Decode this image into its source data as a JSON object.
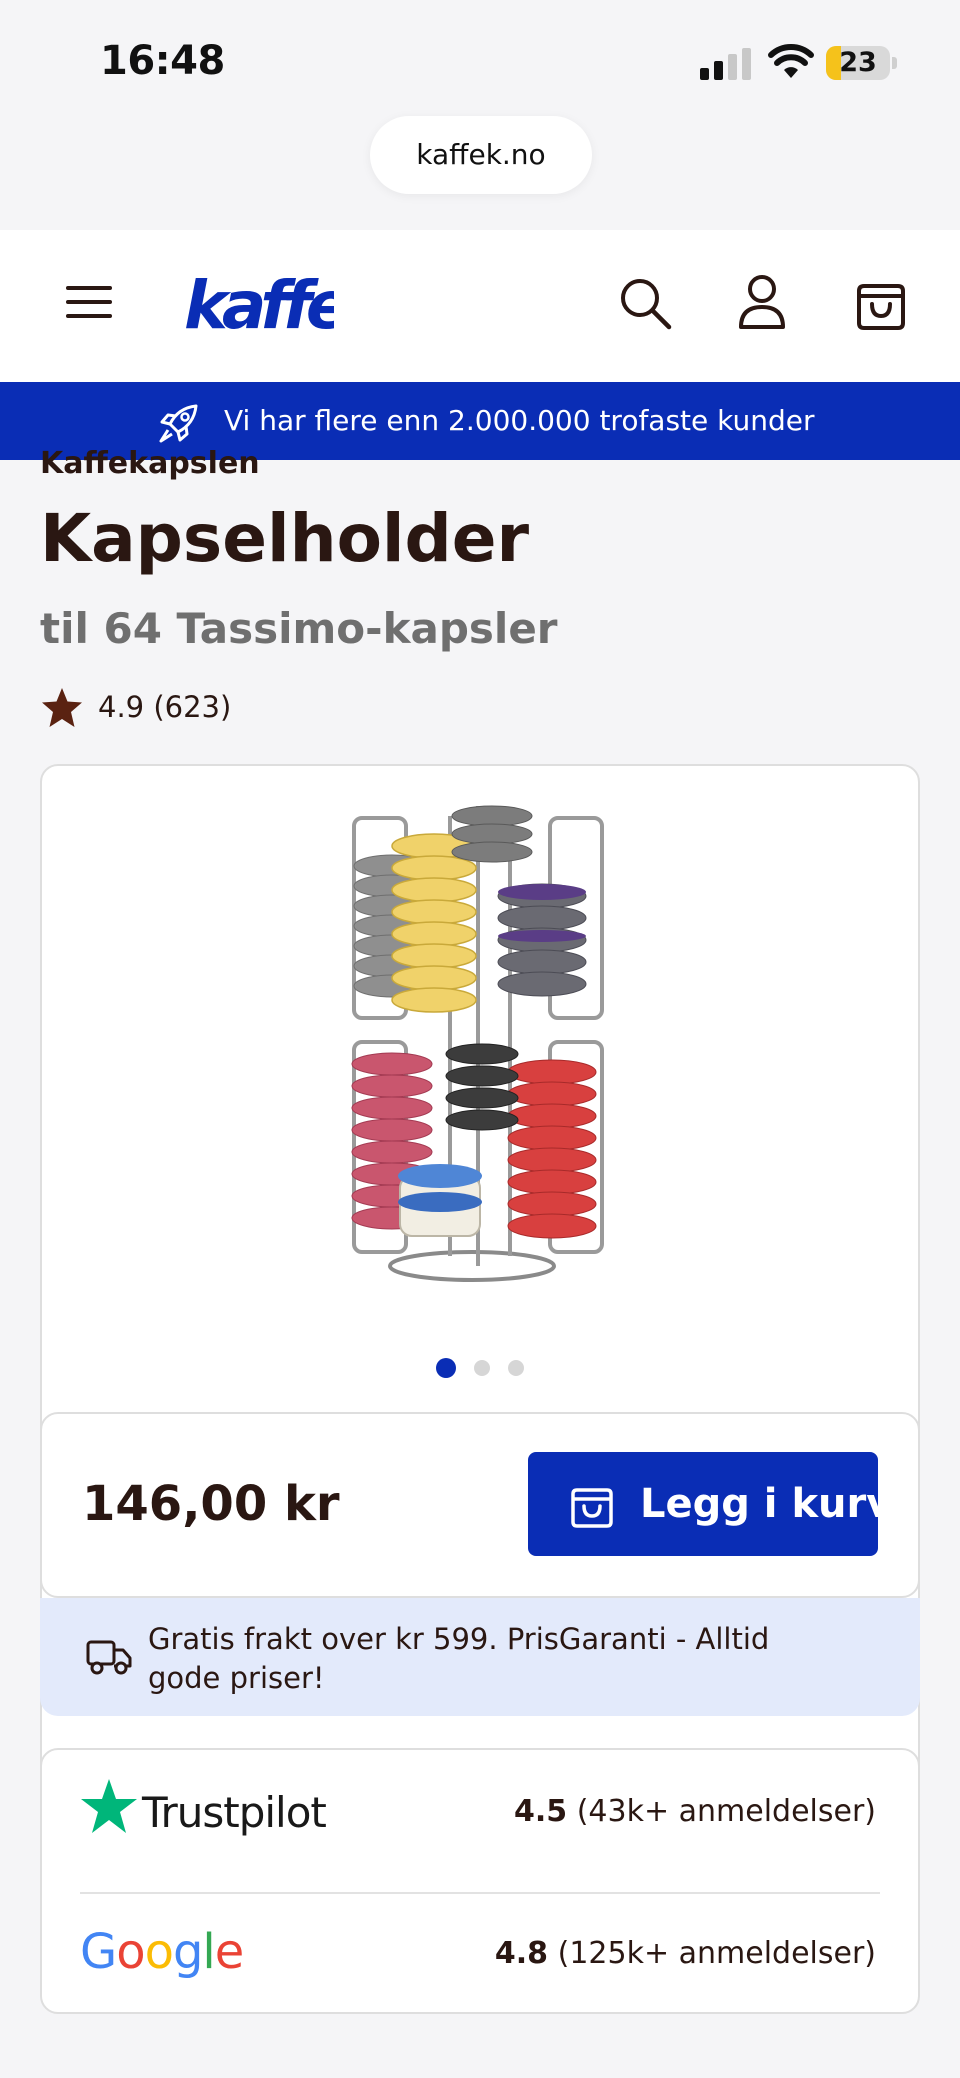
{
  "status_bar": {
    "time": "16:48",
    "battery": "23",
    "battery_level": 0.23
  },
  "browser": {
    "url": "kaffek.no"
  },
  "header": {
    "logo": "kaffek",
    "icons": [
      "menu-icon",
      "search-icon",
      "user-icon",
      "bag-icon"
    ]
  },
  "banner": {
    "text": "Vi har flere enn 2.000.000 trofaste kunder",
    "icon": "rocket-icon"
  },
  "product": {
    "brand": "Kaffekapslen",
    "title": "Kapselholder",
    "subtitle": "til 64 Tassimo-kapsler",
    "rating": "4.9 (623)",
    "carousel": {
      "total": 3,
      "active": 1
    },
    "price": "146,00 kr",
    "cart_label": "Legg i kurv",
    "shipping_text": "Gratis frakt over kr 599. PrisGaranti - Alltid gode priser!"
  },
  "reviews": {
    "trustpilot": {
      "name": "Trustpilot",
      "score": "4.5",
      "count": "(43k+ anmeldelser)"
    },
    "google": {
      "name": "Google",
      "score": "4.8",
      "count": "(125k+ anmeldelser)"
    }
  },
  "colors": {
    "brand_blue": "#0a2db5",
    "text_brown": "#2a1712",
    "star_brown": "#5a2211",
    "trustpilot_green": "#00b67a",
    "shipping_bg": "#e3eafb"
  }
}
